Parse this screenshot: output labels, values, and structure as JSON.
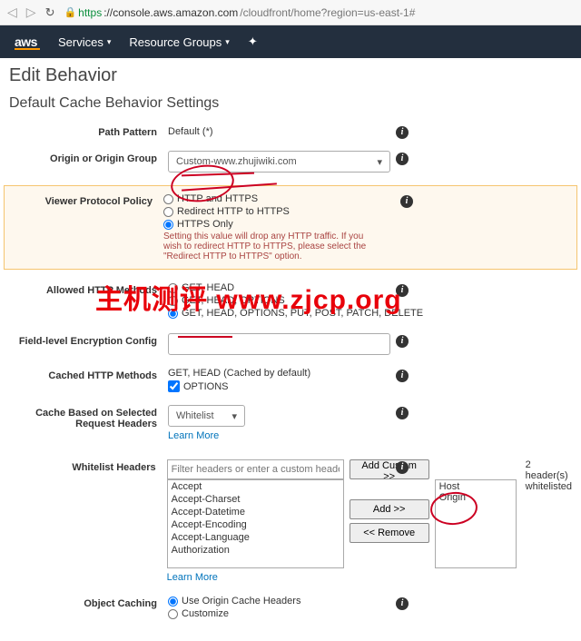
{
  "browser": {
    "url_https": "https",
    "url_host": "://console.aws.amazon.com",
    "url_path": "/cloudfront/home?region=us-east-1#"
  },
  "header": {
    "logo": "aws",
    "services": "Services",
    "resource_groups": "Resource Groups"
  },
  "page": {
    "title": "Edit Behavior",
    "section": "Default Cache Behavior Settings"
  },
  "labels": {
    "path_pattern": "Path Pattern",
    "origin": "Origin or Origin Group",
    "viewer_protocol": "Viewer Protocol Policy",
    "allowed_methods": "Allowed HTTP Methods",
    "field_encryption": "Field-level Encryption Config",
    "cached_methods": "Cached HTTP Methods",
    "cache_headers": "Cache Based on Selected Request Headers",
    "whitelist_headers": "Whitelist Headers",
    "object_caching": "Object Caching"
  },
  "values": {
    "path_pattern": "Default (*)",
    "origin_select": "Custom-www.zhujiwiki.com",
    "cached_default": "GET, HEAD (Cached by default)",
    "cached_options": "OPTIONS",
    "whitelist_select": "Whitelist",
    "filter_placeholder": "Filter headers or enter a custom header",
    "whitelisted_count": "2 header(s) whitelisted",
    "learn_more": "Learn More"
  },
  "protocol_options": {
    "both": "HTTP and HTTPS",
    "redirect": "Redirect HTTP to HTTPS",
    "https_only": "HTTPS Only",
    "warning": "Setting this value will drop any HTTP traffic. If you wish to redirect HTTP to HTTPS, please select the \"Redirect HTTP to HTTPS\" option."
  },
  "method_options": {
    "get_head": "GET, HEAD",
    "get_head_options": "GET, HEAD, OPTIONS",
    "all": "GET, HEAD, OPTIONS, PUT, POST, PATCH, DELETE"
  },
  "caching_options": {
    "origin": "Use Origin Cache Headers",
    "customize": "Customize"
  },
  "available_headers": [
    "Accept",
    "Accept-Charset",
    "Accept-Datetime",
    "Accept-Encoding",
    "Accept-Language",
    "Authorization"
  ],
  "whitelisted_headers": [
    "Host",
    "Origin"
  ],
  "buttons": {
    "add_custom": "Add Custom >>",
    "add": "Add >>",
    "remove": "<< Remove"
  },
  "watermark": "主机测评  www.zjcp.org"
}
